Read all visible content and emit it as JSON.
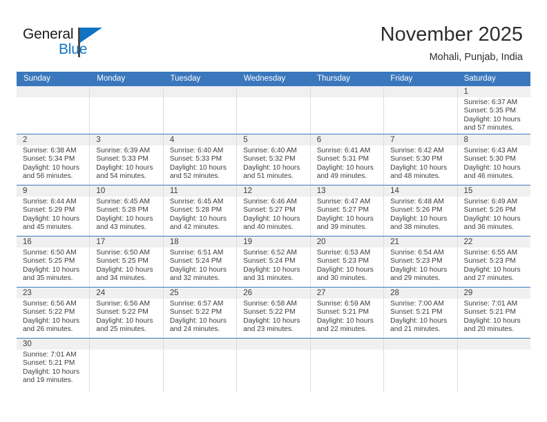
{
  "brand": {
    "name_top": "General",
    "name_bottom": "Blue",
    "accent_color": "#1273c4"
  },
  "header": {
    "month_title": "November 2025",
    "location": "Mohali, Punjab, India"
  },
  "colors": {
    "header_bar": "#3a77bd",
    "day_number_band": "#f0f0f0",
    "row_divider": "#3a77bd",
    "column_divider": "#dcdcdc",
    "text": "#3c3c3c"
  },
  "weekdays": [
    "Sunday",
    "Monday",
    "Tuesday",
    "Wednesday",
    "Thursday",
    "Friday",
    "Saturday"
  ],
  "labels": {
    "sunrise_prefix": "Sunrise:",
    "sunset_prefix": "Sunset:",
    "daylight_prefix": "Daylight:"
  },
  "weeks": [
    {
      "days": [
        {
          "empty": true
        },
        {
          "empty": true
        },
        {
          "empty": true
        },
        {
          "empty": true
        },
        {
          "empty": true
        },
        {
          "empty": true
        },
        {
          "num": "1",
          "sunrise": "Sunrise: 6:37 AM",
          "sunset": "Sunset: 5:35 PM",
          "daylight": "Daylight: 10 hours and 57 minutes."
        }
      ]
    },
    {
      "days": [
        {
          "num": "2",
          "sunrise": "Sunrise: 6:38 AM",
          "sunset": "Sunset: 5:34 PM",
          "daylight": "Daylight: 10 hours and 56 minutes."
        },
        {
          "num": "3",
          "sunrise": "Sunrise: 6:39 AM",
          "sunset": "Sunset: 5:33 PM",
          "daylight": "Daylight: 10 hours and 54 minutes."
        },
        {
          "num": "4",
          "sunrise": "Sunrise: 6:40 AM",
          "sunset": "Sunset: 5:33 PM",
          "daylight": "Daylight: 10 hours and 52 minutes."
        },
        {
          "num": "5",
          "sunrise": "Sunrise: 6:40 AM",
          "sunset": "Sunset: 5:32 PM",
          "daylight": "Daylight: 10 hours and 51 minutes."
        },
        {
          "num": "6",
          "sunrise": "Sunrise: 6:41 AM",
          "sunset": "Sunset: 5:31 PM",
          "daylight": "Daylight: 10 hours and 49 minutes."
        },
        {
          "num": "7",
          "sunrise": "Sunrise: 6:42 AM",
          "sunset": "Sunset: 5:30 PM",
          "daylight": "Daylight: 10 hours and 48 minutes."
        },
        {
          "num": "8",
          "sunrise": "Sunrise: 6:43 AM",
          "sunset": "Sunset: 5:30 PM",
          "daylight": "Daylight: 10 hours and 46 minutes."
        }
      ]
    },
    {
      "days": [
        {
          "num": "9",
          "sunrise": "Sunrise: 6:44 AM",
          "sunset": "Sunset: 5:29 PM",
          "daylight": "Daylight: 10 hours and 45 minutes."
        },
        {
          "num": "10",
          "sunrise": "Sunrise: 6:45 AM",
          "sunset": "Sunset: 5:28 PM",
          "daylight": "Daylight: 10 hours and 43 minutes."
        },
        {
          "num": "11",
          "sunrise": "Sunrise: 6:45 AM",
          "sunset": "Sunset: 5:28 PM",
          "daylight": "Daylight: 10 hours and 42 minutes."
        },
        {
          "num": "12",
          "sunrise": "Sunrise: 6:46 AM",
          "sunset": "Sunset: 5:27 PM",
          "daylight": "Daylight: 10 hours and 40 minutes."
        },
        {
          "num": "13",
          "sunrise": "Sunrise: 6:47 AM",
          "sunset": "Sunset: 5:27 PM",
          "daylight": "Daylight: 10 hours and 39 minutes."
        },
        {
          "num": "14",
          "sunrise": "Sunrise: 6:48 AM",
          "sunset": "Sunset: 5:26 PM",
          "daylight": "Daylight: 10 hours and 38 minutes."
        },
        {
          "num": "15",
          "sunrise": "Sunrise: 6:49 AM",
          "sunset": "Sunset: 5:26 PM",
          "daylight": "Daylight: 10 hours and 36 minutes."
        }
      ]
    },
    {
      "days": [
        {
          "num": "16",
          "sunrise": "Sunrise: 6:50 AM",
          "sunset": "Sunset: 5:25 PM",
          "daylight": "Daylight: 10 hours and 35 minutes."
        },
        {
          "num": "17",
          "sunrise": "Sunrise: 6:50 AM",
          "sunset": "Sunset: 5:25 PM",
          "daylight": "Daylight: 10 hours and 34 minutes."
        },
        {
          "num": "18",
          "sunrise": "Sunrise: 6:51 AM",
          "sunset": "Sunset: 5:24 PM",
          "daylight": "Daylight: 10 hours and 32 minutes."
        },
        {
          "num": "19",
          "sunrise": "Sunrise: 6:52 AM",
          "sunset": "Sunset: 5:24 PM",
          "daylight": "Daylight: 10 hours and 31 minutes."
        },
        {
          "num": "20",
          "sunrise": "Sunrise: 6:53 AM",
          "sunset": "Sunset: 5:23 PM",
          "daylight": "Daylight: 10 hours and 30 minutes."
        },
        {
          "num": "21",
          "sunrise": "Sunrise: 6:54 AM",
          "sunset": "Sunset: 5:23 PM",
          "daylight": "Daylight: 10 hours and 29 minutes."
        },
        {
          "num": "22",
          "sunrise": "Sunrise: 6:55 AM",
          "sunset": "Sunset: 5:23 PM",
          "daylight": "Daylight: 10 hours and 27 minutes."
        }
      ]
    },
    {
      "days": [
        {
          "num": "23",
          "sunrise": "Sunrise: 6:56 AM",
          "sunset": "Sunset: 5:22 PM",
          "daylight": "Daylight: 10 hours and 26 minutes."
        },
        {
          "num": "24",
          "sunrise": "Sunrise: 6:56 AM",
          "sunset": "Sunset: 5:22 PM",
          "daylight": "Daylight: 10 hours and 25 minutes."
        },
        {
          "num": "25",
          "sunrise": "Sunrise: 6:57 AM",
          "sunset": "Sunset: 5:22 PM",
          "daylight": "Daylight: 10 hours and 24 minutes."
        },
        {
          "num": "26",
          "sunrise": "Sunrise: 6:58 AM",
          "sunset": "Sunset: 5:22 PM",
          "daylight": "Daylight: 10 hours and 23 minutes."
        },
        {
          "num": "27",
          "sunrise": "Sunrise: 6:59 AM",
          "sunset": "Sunset: 5:21 PM",
          "daylight": "Daylight: 10 hours and 22 minutes."
        },
        {
          "num": "28",
          "sunrise": "Sunrise: 7:00 AM",
          "sunset": "Sunset: 5:21 PM",
          "daylight": "Daylight: 10 hours and 21 minutes."
        },
        {
          "num": "29",
          "sunrise": "Sunrise: 7:01 AM",
          "sunset": "Sunset: 5:21 PM",
          "daylight": "Daylight: 10 hours and 20 minutes."
        }
      ]
    },
    {
      "days": [
        {
          "num": "30",
          "sunrise": "Sunrise: 7:01 AM",
          "sunset": "Sunset: 5:21 PM",
          "daylight": "Daylight: 10 hours and 19 minutes."
        },
        {
          "blank": true
        },
        {
          "blank": true
        },
        {
          "blank": true
        },
        {
          "blank": true
        },
        {
          "blank": true
        },
        {
          "blank": true
        }
      ]
    }
  ]
}
